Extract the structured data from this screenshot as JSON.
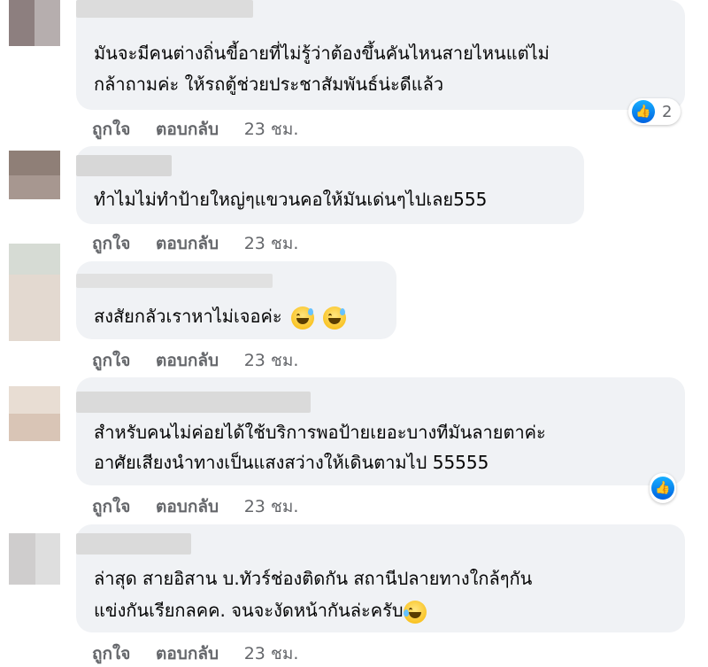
{
  "comments": [
    {
      "text_lines": [
        "มันจะมีคนต่างถิ่นขี้อายที่ไม่รู้ว่าต้องขึ้นคันไหนสายไหนแต่ไม่",
        "กล้าถามค่ะ ให้รถตู้ช่วยประชาสัมพันธ์น่ะดีแล้ว"
      ],
      "like": "ถูกใจ",
      "reply": "ตอบกลับ",
      "time": "23 ชม.",
      "reaction_count": "2"
    },
    {
      "text_lines": [
        "ทำไมไม่ทำป้ายใหญ่ๆแขวนคอให้มันเด่นๆไปเลย555"
      ],
      "like": "ถูกใจ",
      "reply": "ตอบกลับ",
      "time": "23 ชม."
    },
    {
      "text_lines": [
        "สงสัยกลัวเราหาไม่เจอค่ะ"
      ],
      "like": "ถูกใจ",
      "reply": "ตอบกลับ",
      "time": "23 ชม."
    },
    {
      "text_lines": [
        "สำหรับคนไม่ค่อยได้ใช้บริการพอป้ายเยอะบางทีมันลายตาค่ะ",
        "อาศัยเสียงนำทางเป็นแสงสว่างให้เดินตามไป 55555"
      ],
      "like": "ถูกใจ",
      "reply": "ตอบกลับ",
      "time": "23 ชม."
    },
    {
      "text_lines": [
        "ล่าสุด สายอิสาน บ.ทัวร์ช่องติดกัน สถานีปลายทางใกล้ๆกัน",
        "แข่งกันเรียกลคค. จนจะงัดหน้ากันล่ะครับ"
      ],
      "like": "ถูกใจ",
      "reply": "ตอบกลับ",
      "time": "23 ชม."
    }
  ]
}
